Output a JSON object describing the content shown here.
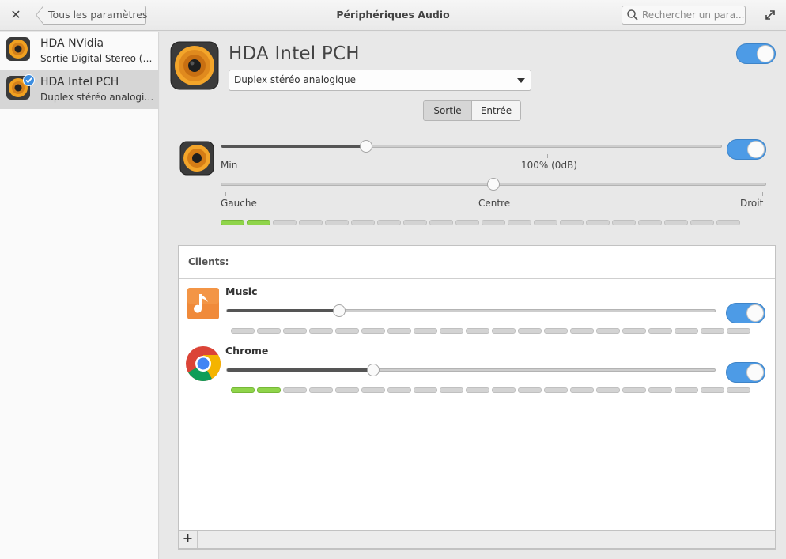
{
  "window": {
    "title": "Périphériques Audio",
    "back_label": "Tous les paramètres",
    "search_placeholder": "Rechercher un para..."
  },
  "sidebar": {
    "devices": [
      {
        "name": "HDA NVidia",
        "subtitle": "Sortie Digital Stereo (H...",
        "selected": false
      },
      {
        "name": "HDA Intel PCH",
        "subtitle": "Duplex stéréo analogique",
        "selected": true
      }
    ]
  },
  "device": {
    "name": "HDA Intel PCH",
    "profile": "Duplex stéréo analogique",
    "enabled": true,
    "tabs": [
      "Sortie",
      "Entrée"
    ],
    "active_tab": "Sortie",
    "volume": {
      "min_label": "Min",
      "reference_label": "100% (0dB)",
      "value_fraction": 0.29,
      "muted": false
    },
    "balance": {
      "left_label": "Gauche",
      "center_label": "Centre",
      "right_label": "Droit",
      "value_fraction": 0.5
    },
    "level_meter": {
      "segments": 20,
      "active": 2
    }
  },
  "clients": {
    "header": "Clients:",
    "items": [
      {
        "name": "Music",
        "icon": "music-note-icon",
        "volume_fraction": 0.23,
        "enabled": true,
        "level_active": 0,
        "segments": 20
      },
      {
        "name": "Chrome",
        "icon": "chrome-icon",
        "volume_fraction": 0.3,
        "enabled": true,
        "level_active": 2,
        "segments": 20
      }
    ],
    "add_label": "+"
  },
  "colors": {
    "accent": "#4d9be6",
    "level_on": "#8fd44a",
    "selected_row": "#d6d6d6"
  }
}
